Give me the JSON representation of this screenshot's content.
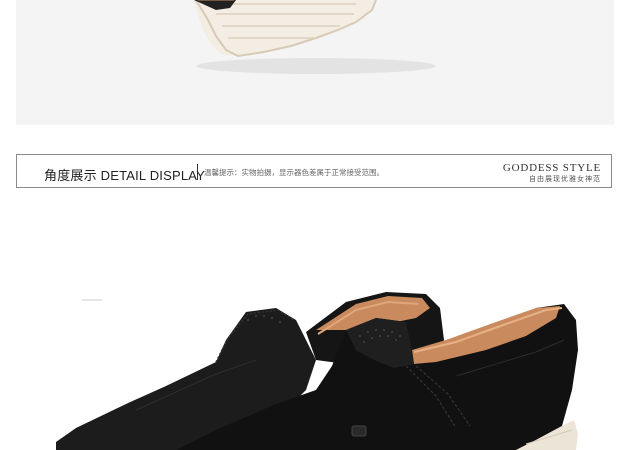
{
  "header": {
    "title": "角度展示 DETAIL DISPLAY",
    "note": "温馨提示：实物拍摄，显示器色差属于正常接受范围。",
    "brand_en": "GODDESS STYLE",
    "brand_cn": "自由展现优雅女神范"
  },
  "images": {
    "top": "shoe-sole-closeup",
    "bottom": "black-suede-loafers-pair"
  },
  "colors": {
    "suede": "#1a1a1a",
    "lining": "#c98a5e",
    "sole": "#ece4d6",
    "border": "#8a8a8a"
  }
}
